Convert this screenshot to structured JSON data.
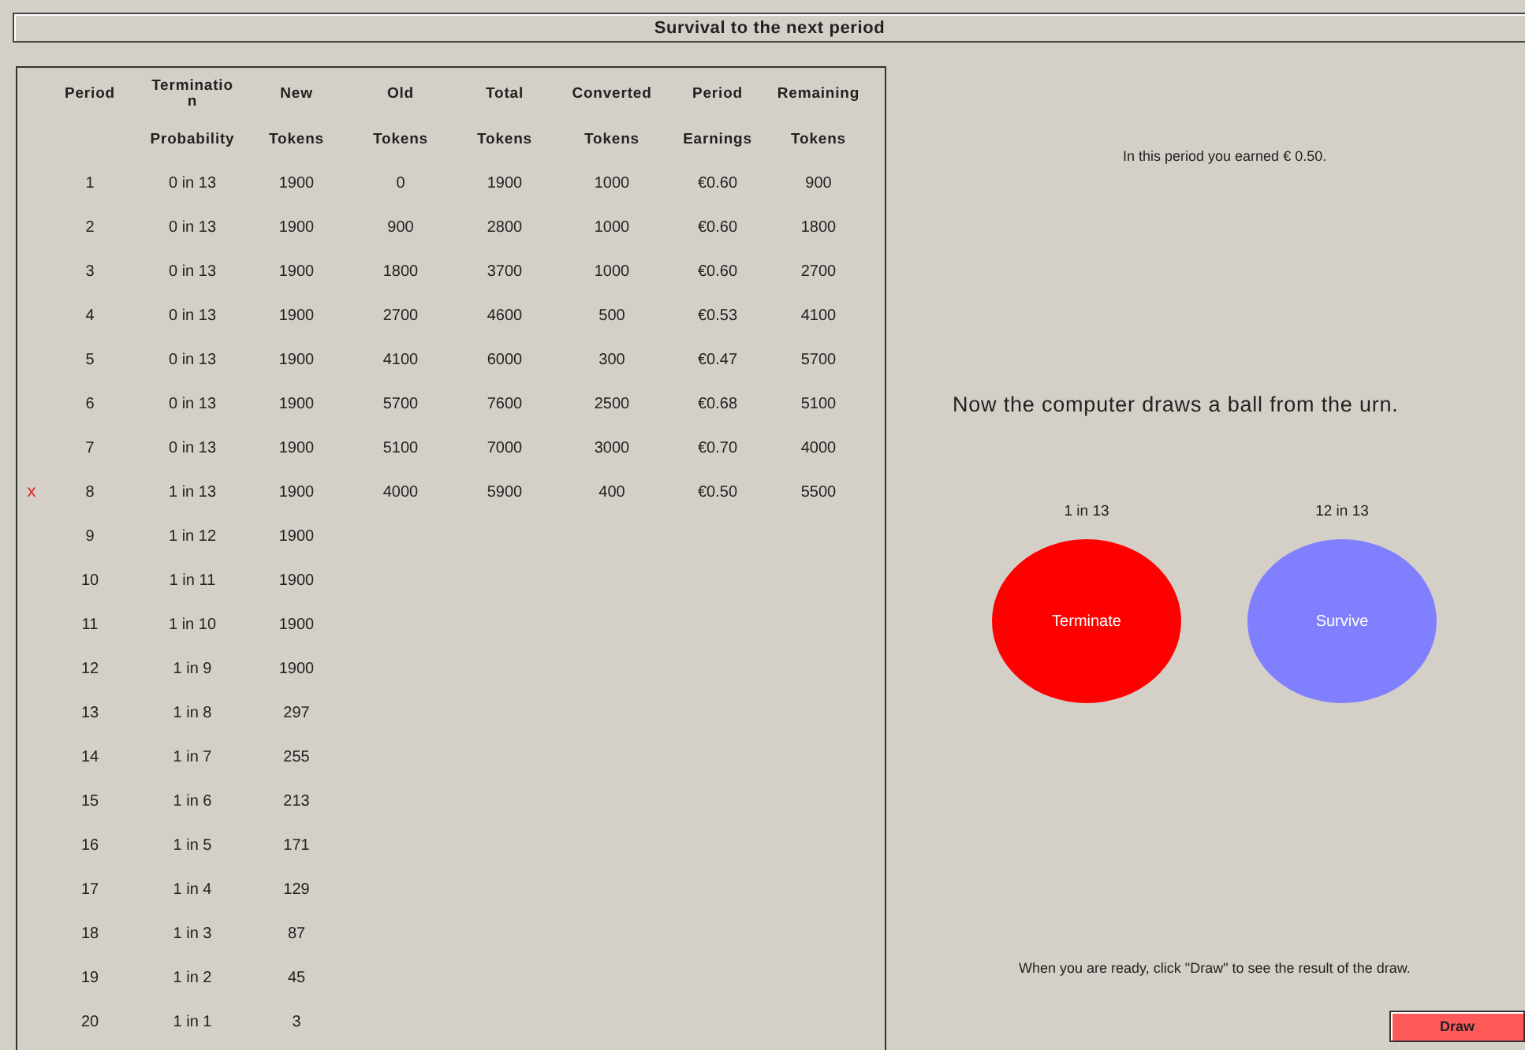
{
  "window": {
    "title": "Survival to the next period"
  },
  "table": {
    "columns": [
      {
        "top": "Period"
      },
      {
        "top": "Termination",
        "bottom": "Probability"
      },
      {
        "top": "New",
        "bottom": "Tokens"
      },
      {
        "top": "Old",
        "bottom": "Tokens"
      },
      {
        "top": "Total",
        "bottom": "Tokens"
      },
      {
        "top": "Converted",
        "bottom": "Tokens"
      },
      {
        "top": "Period",
        "bottom": "Earnings"
      },
      {
        "top": "Remaining",
        "bottom": "Tokens"
      }
    ],
    "rows": [
      {
        "marker": "",
        "cells": [
          "1",
          "0 in 13",
          "1900",
          "0",
          "1900",
          "1000",
          "€0.60",
          "900"
        ]
      },
      {
        "marker": "",
        "cells": [
          "2",
          "0 in 13",
          "1900",
          "900",
          "2800",
          "1000",
          "€0.60",
          "1800"
        ]
      },
      {
        "marker": "",
        "cells": [
          "3",
          "0 in 13",
          "1900",
          "1800",
          "3700",
          "1000",
          "€0.60",
          "2700"
        ]
      },
      {
        "marker": "",
        "cells": [
          "4",
          "0 in 13",
          "1900",
          "2700",
          "4600",
          "500",
          "€0.53",
          "4100"
        ]
      },
      {
        "marker": "",
        "cells": [
          "5",
          "0 in 13",
          "1900",
          "4100",
          "6000",
          "300",
          "€0.47",
          "5700"
        ]
      },
      {
        "marker": "",
        "cells": [
          "6",
          "0 in 13",
          "1900",
          "5700",
          "7600",
          "2500",
          "€0.68",
          "5100"
        ]
      },
      {
        "marker": "",
        "cells": [
          "7",
          "0 in 13",
          "1900",
          "5100",
          "7000",
          "3000",
          "€0.70",
          "4000"
        ]
      },
      {
        "marker": "x",
        "cells": [
          "8",
          "1 in 13",
          "1900",
          "4000",
          "5900",
          "400",
          "€0.50",
          "5500"
        ]
      },
      {
        "marker": "",
        "cells": [
          "9",
          "1 in 12",
          "1900"
        ]
      },
      {
        "marker": "",
        "cells": [
          "10",
          "1 in 11",
          "1900"
        ]
      },
      {
        "marker": "",
        "cells": [
          "11",
          "1 in 10",
          "1900"
        ]
      },
      {
        "marker": "",
        "cells": [
          "12",
          "1 in 9",
          "1900"
        ]
      },
      {
        "marker": "",
        "cells": [
          "13",
          "1 in 8",
          "297"
        ]
      },
      {
        "marker": "",
        "cells": [
          "14",
          "1 in 7",
          "255"
        ]
      },
      {
        "marker": "",
        "cells": [
          "15",
          "1 in 6",
          "213"
        ]
      },
      {
        "marker": "",
        "cells": [
          "16",
          "1 in 5",
          "171"
        ]
      },
      {
        "marker": "",
        "cells": [
          "17",
          "1 in 4",
          "129"
        ]
      },
      {
        "marker": "",
        "cells": [
          "18",
          "1 in 3",
          "87"
        ]
      },
      {
        "marker": "",
        "cells": [
          "19",
          "1 in 2",
          "45"
        ]
      },
      {
        "marker": "",
        "cells": [
          "20",
          "1 in 1",
          "3"
        ]
      }
    ]
  },
  "earned_message": "In this period you earned € 0.50.",
  "draw_message": "Now the computer draws a ball from the urn.",
  "balls": [
    {
      "odds": "1 in 13",
      "label": "Terminate",
      "color": "#ff0000"
    },
    {
      "odds": "12 in 13",
      "label": "Survive",
      "color": "#8080ff"
    }
  ],
  "instruction": "When you are ready, click \"Draw\" to see the result of the draw.",
  "buttons": [
    {
      "label": "Draw"
    }
  ]
}
